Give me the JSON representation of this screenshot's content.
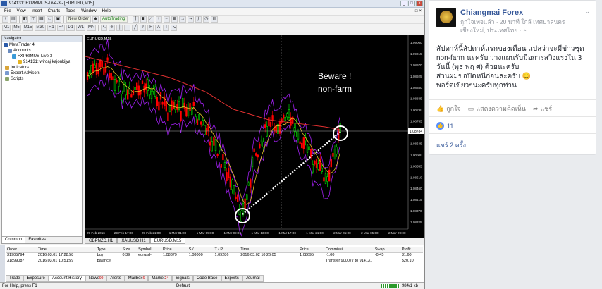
{
  "mt4": {
    "title": "914131: FXPRIMUS-Live-3 - [EURUSD,M15]",
    "window_buttons": [
      "_",
      "□",
      "×"
    ],
    "menu": [
      "File",
      "View",
      "Insert",
      "Charts",
      "Tools",
      "Window",
      "Help"
    ],
    "menu_chart_controls": [
      "_",
      "□",
      "×"
    ],
    "toolbar": {
      "new_order": "New Order",
      "autotrading": "AutoTrading",
      "timeframes": [
        "M1",
        "M5",
        "M15",
        "M30",
        "H1",
        "H4",
        "D1",
        "W1",
        "MN"
      ]
    },
    "navigator": {
      "header": "Navigator",
      "root": "MetaTrader 4",
      "accounts": "Accounts",
      "server": "FXPRIMUS-Live-3",
      "account": "914131: wiroaj kajonkijya",
      "indicators": "Indicators",
      "experts": "Expert Advisors",
      "scripts": "Scripts",
      "tabs": [
        "Common",
        "Favorites"
      ]
    },
    "chart": {
      "symbol_label": "EURUSD,M15",
      "annotation_line1": "Beware !",
      "annotation_line2": "non-farm",
      "current_price": "1.08784",
      "price_ticks": [
        "1.09060",
        "1.09015",
        "1.08970",
        "1.08925",
        "1.08880",
        "1.08835",
        "1.08790",
        "1.08735",
        "1.08690",
        "1.08645",
        "1.08600",
        "1.08555",
        "1.08510",
        "1.08460",
        "1.08415",
        "1.08370",
        "1.08325"
      ],
      "time_ticks": [
        "29 Feb 2016",
        "29 Feb 17:00",
        "29 Feb 21:00",
        "1 Mar 01:00",
        "1 Mar 05:00",
        "1 Mar 09:00",
        "1 Mar 13:00",
        "1 Mar 17:00",
        "1 Mar 21:00",
        "2 Mar 01:00",
        "2 Mar 05:00",
        "2 Mar 09:00"
      ],
      "tabs": [
        "GBPNZD,H1",
        "XAUUSD,H1",
        "EURUSD,M15"
      ],
      "colors": {
        "background": "#000000",
        "bull": "#00ff00",
        "bear": "#ff0000",
        "ma_red": "#e03030",
        "bands": "#a020f0",
        "ma_yellow": "#e6c229",
        "annotation": "#ffffff"
      }
    },
    "terminal": {
      "side_label": "Terminal",
      "columns": [
        "Order",
        "Time",
        "Type",
        "Size",
        "Symbol",
        "Price",
        "S / L",
        "T / P",
        "Time",
        "Price",
        "Commissi...",
        "Swap",
        "Profit"
      ],
      "rows": [
        [
          "31905794",
          "2016.03.01 17:28:58",
          "buy",
          "0.39",
          "eurusd-",
          "1.08379",
          "1.08000",
          "1.09286",
          "2016.03.02 10:26:05",
          "1.08695",
          "-1.00",
          "-0.45",
          "31.60"
        ],
        [
          "31899087",
          "2016.03.01 10:51:59",
          "balance",
          "",
          "",
          "",
          "",
          "",
          "",
          "",
          "Transfer 900077 to 914131",
          "",
          "520.10"
        ]
      ],
      "tabs": [
        {
          "label": "Trade",
          "badge": ""
        },
        {
          "label": "Exposure",
          "badge": ""
        },
        {
          "label": "Account History",
          "badge": ""
        },
        {
          "label": "News",
          "badge": "99"
        },
        {
          "label": "Alerts",
          "badge": ""
        },
        {
          "label": "Mailbox",
          "badge": "6"
        },
        {
          "label": "Market",
          "badge": "24"
        },
        {
          "label": "Signals",
          "badge": ""
        },
        {
          "label": "Code Base",
          "badge": ""
        },
        {
          "label": "Experts",
          "badge": ""
        },
        {
          "label": "Journal",
          "badge": ""
        }
      ]
    },
    "status": {
      "left": "For Help, press F1",
      "mid": "Default",
      "right": "984/1 kb"
    }
  },
  "facebook": {
    "page_name": "Chiangmai Forex",
    "meta_line1": "ถูกใจเพจแล้ว · 20 นาที ใกล้ เทศบาลนคร",
    "meta_line2": "เชียงใหม่, ประเทศไทย · ",
    "body_line1": "สัปดาห์นี้สัปดาห์แรกของเดือน แปลว่าจะมีข่าวชุด",
    "body_line2": "non-farm นะครับ วางแผนรับมือการสวิงแรงใน 3",
    "body_line3": "วันนี้ (พุธ พฤ ศ) ด้วยนะครับ",
    "body_line4": "ส่วนผมขอปิดหนีก่อนละครับ 😊",
    "body_line5": "พอร์ตเขียวๆนะครับทุกท่าน",
    "actions": {
      "like": "ถูกใจ",
      "comment": "แสดงความคิดเห็น",
      "share": "แชร์"
    },
    "like_count": "11",
    "shares": "แชร์ 2 ครั้ง",
    "accent": "#365899"
  }
}
